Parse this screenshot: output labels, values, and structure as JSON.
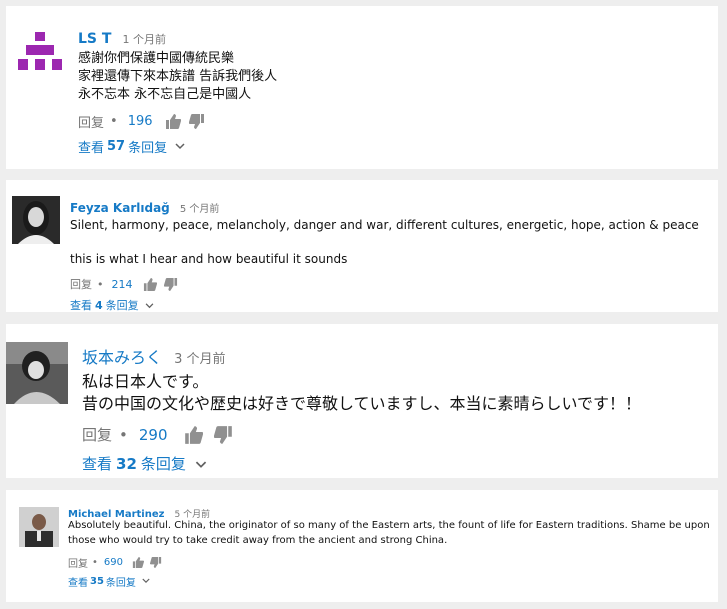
{
  "comments": [
    {
      "author": "LS T",
      "time": "1 个月前",
      "lines": [
        "感謝你們保護中國傳統民樂",
        "家裡還傳下來本族譜 告訴我們後人",
        "永不忘本 永不忘自己是中國人"
      ],
      "reply_label": "回复",
      "dot": "•",
      "likes": "196",
      "view_prefix": "查看",
      "reply_count": "57",
      "view_suffix": "条回复",
      "chevron": "⌄"
    },
    {
      "author": "Feyza Karlıdağ",
      "time": "5 个月前",
      "lines": [
        "Silent, harmony, peace, melancholy, danger and war, different cultures, energetic, hope,   action & peace",
        "this is what I hear and how beautiful it sounds"
      ],
      "reply_label": "回复",
      "dot": "•",
      "likes": "214",
      "view_prefix": "查看",
      "reply_count": "4",
      "view_suffix": "条回复",
      "chevron": "⌄"
    },
    {
      "author": "坂本みろく",
      "time": "3 个月前",
      "lines": [
        "私は日本人です。",
        "昔の中国の文化や歴史は好きで尊敬していますし、本当に素晴らしいです！！"
      ],
      "reply_label": "回复",
      "dot": "•",
      "likes": "290",
      "view_prefix": "查看",
      "reply_count": "32",
      "view_suffix": "条回复",
      "chevron": "⌄"
    },
    {
      "author": "Michael Martinez",
      "time": "5 个月前",
      "lines": [
        "Absolutely beautiful. China, the originator of so many of the Eastern arts, the fount of life for Eastern traditions. Shame be upon",
        "those who would try to take credit away from the ancient and strong China."
      ],
      "reply_label": "回复",
      "dot": "•",
      "likes": "690",
      "view_prefix": "查看",
      "reply_count": "35",
      "view_suffix": "条回复",
      "chevron": "⌄"
    }
  ],
  "colors": {
    "link": "#167ac6",
    "meta": "#767676",
    "identicon": "#9c27b0",
    "background": "#eeeeee"
  },
  "icons": [
    "identicon-avatar",
    "thumb-up-icon",
    "thumb-down-icon",
    "chevron-down-icon"
  ]
}
